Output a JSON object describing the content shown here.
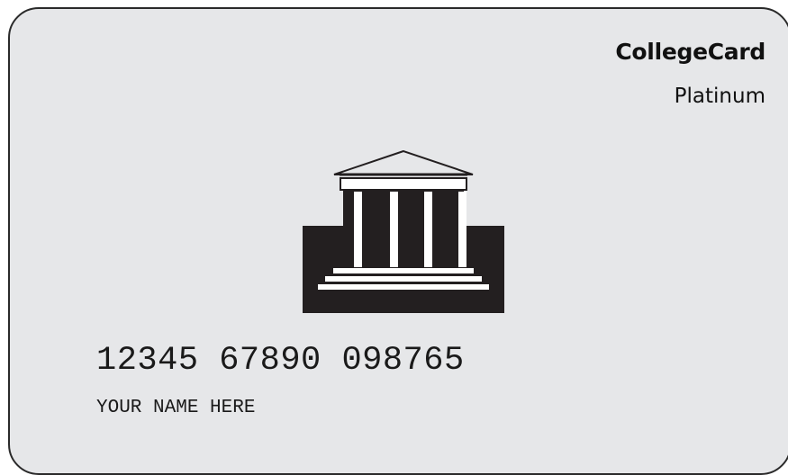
{
  "card": {
    "brand": "CollegeCard",
    "tier": "Platinum",
    "number": "12345 67890 098765",
    "holder": "YOUR NAME HERE",
    "logo_icon": "bank-building-icon"
  },
  "colors": {
    "card_background": "#e6e7e9",
    "card_border": "#2a2a2a",
    "logo_fill": "#231f20",
    "logo_light": "#ffffff",
    "text": "#111111"
  }
}
